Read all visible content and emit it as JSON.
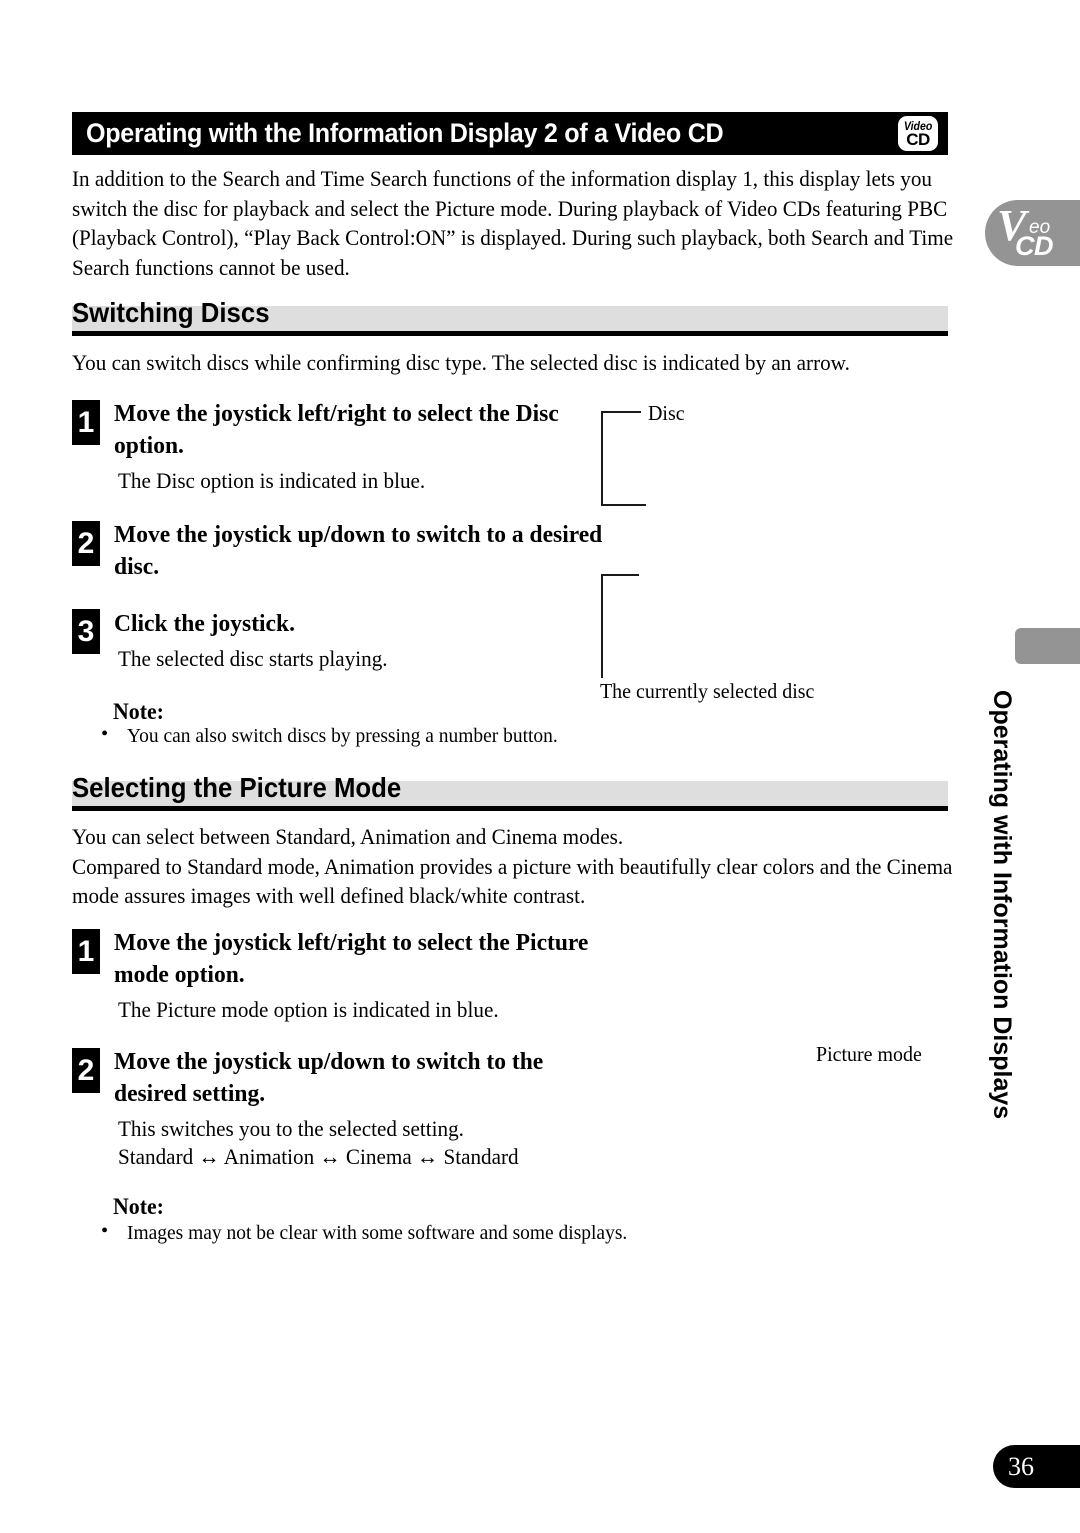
{
  "header": {
    "title": "Operating with the Information Display 2 of a Video CD",
    "badge": {
      "top": "Video",
      "bottom": "CD"
    }
  },
  "intro": "In addition to the Search and Time Search functions of the information display 1, this display lets you switch the disc for playback and select the Picture mode. During playback of Video CDs featuring PBC (Playback Control), “Play Back Control:ON” is displayed. During such playback, both Search and Time Search functions cannot be used.",
  "sections": [
    {
      "heading": "Switching Discs",
      "lead": "You can switch discs while confirming disc type. The selected disc is indicated by an arrow.",
      "steps": [
        {
          "num": "1",
          "title": "Move the joystick left/right to select the Disc option.",
          "body": "The Disc option is indicated in blue."
        },
        {
          "num": "2",
          "title": "Move the joystick up/down to switch to a desired disc.",
          "body": ""
        },
        {
          "num": "3",
          "title": "Click the joystick.",
          "body": "The selected disc starts playing."
        }
      ],
      "note": {
        "label": "Note:",
        "bullet": "•",
        "items": [
          "You can also switch discs by pressing a number button."
        ]
      },
      "callouts": [
        {
          "label": "Disc"
        },
        {
          "label": "The currently selected disc"
        }
      ]
    },
    {
      "heading": "Selecting the Picture Mode",
      "lead": "You can select between Standard, Animation and Cinema modes.\nCompared to Standard mode, Animation provides a picture with beautifully clear colors and the Cinema mode assures images with well defined black/white contrast.",
      "steps": [
        {
          "num": "1",
          "title": "Move the joystick left/right to select the Picture mode option.",
          "body": "The Picture mode option is indicated in blue."
        },
        {
          "num": "2",
          "title": "Move the joystick up/down to switch to the desired setting.",
          "body": "This switches you to the selected setting.",
          "cycle": "Standard ↔ Animation ↔ Cinema ↔ Standard"
        }
      ],
      "note": {
        "label": "Note:",
        "bullet": "•",
        "items": [
          "Images may not be clear with some software and some displays."
        ]
      },
      "callouts": [
        {
          "label": "Picture mode"
        }
      ]
    }
  ],
  "side_tab": {
    "v": "V",
    "eo": "eo",
    "cd": "CD"
  },
  "running_head": "Operating with Information Displays",
  "page_number": "36",
  "colors": {
    "bar": "#000000",
    "band": "#dedede",
    "tab_gray": "#949494",
    "text": "#000000"
  }
}
